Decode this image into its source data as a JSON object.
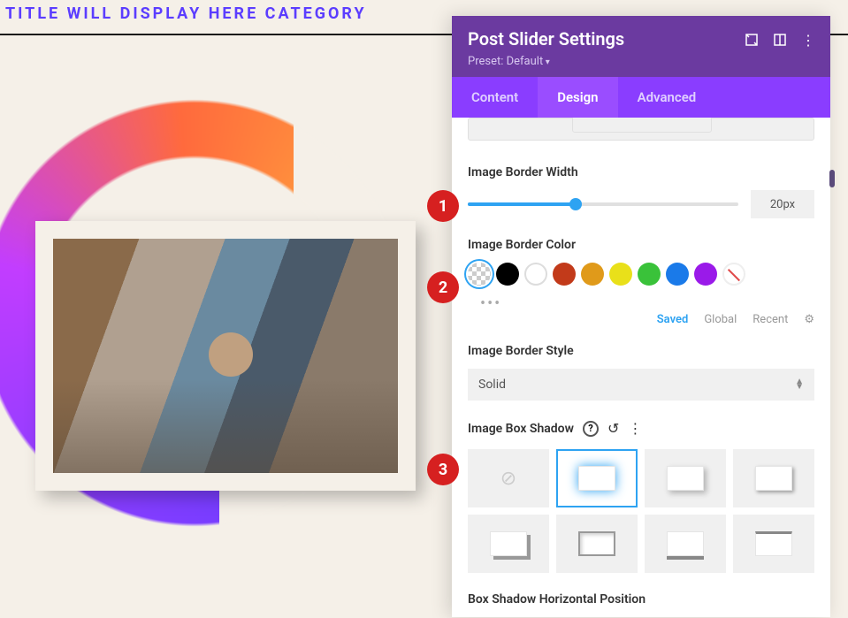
{
  "page_title": "TITLE WILL DISPLAY HERE CATEGORY",
  "panel": {
    "title": "Post Slider Settings",
    "preset": "Preset: Default",
    "tabs": {
      "content": "Content",
      "design": "Design",
      "advanced": "Advanced"
    }
  },
  "border_width": {
    "label": "Image Border Width",
    "value": "20px"
  },
  "border_color": {
    "label": "Image Border Color",
    "swatches": [
      "transparent",
      "#000000",
      "#ffffff",
      "#c23a1a",
      "#e09a1a",
      "#e9e01a",
      "#3ac23a",
      "#1a7ae9",
      "#9a1ae9",
      "none"
    ],
    "active": 0,
    "tabs": {
      "saved": "Saved",
      "global": "Global",
      "recent": "Recent"
    },
    "active_tab": "saved"
  },
  "border_style": {
    "label": "Image Border Style",
    "value": "Solid"
  },
  "box_shadow": {
    "label": "Image Box Shadow",
    "active": 1
  },
  "shadow_h": {
    "label": "Box Shadow Horizontal Position"
  },
  "markers": {
    "m1": "1",
    "m2": "2",
    "m3": "3"
  }
}
